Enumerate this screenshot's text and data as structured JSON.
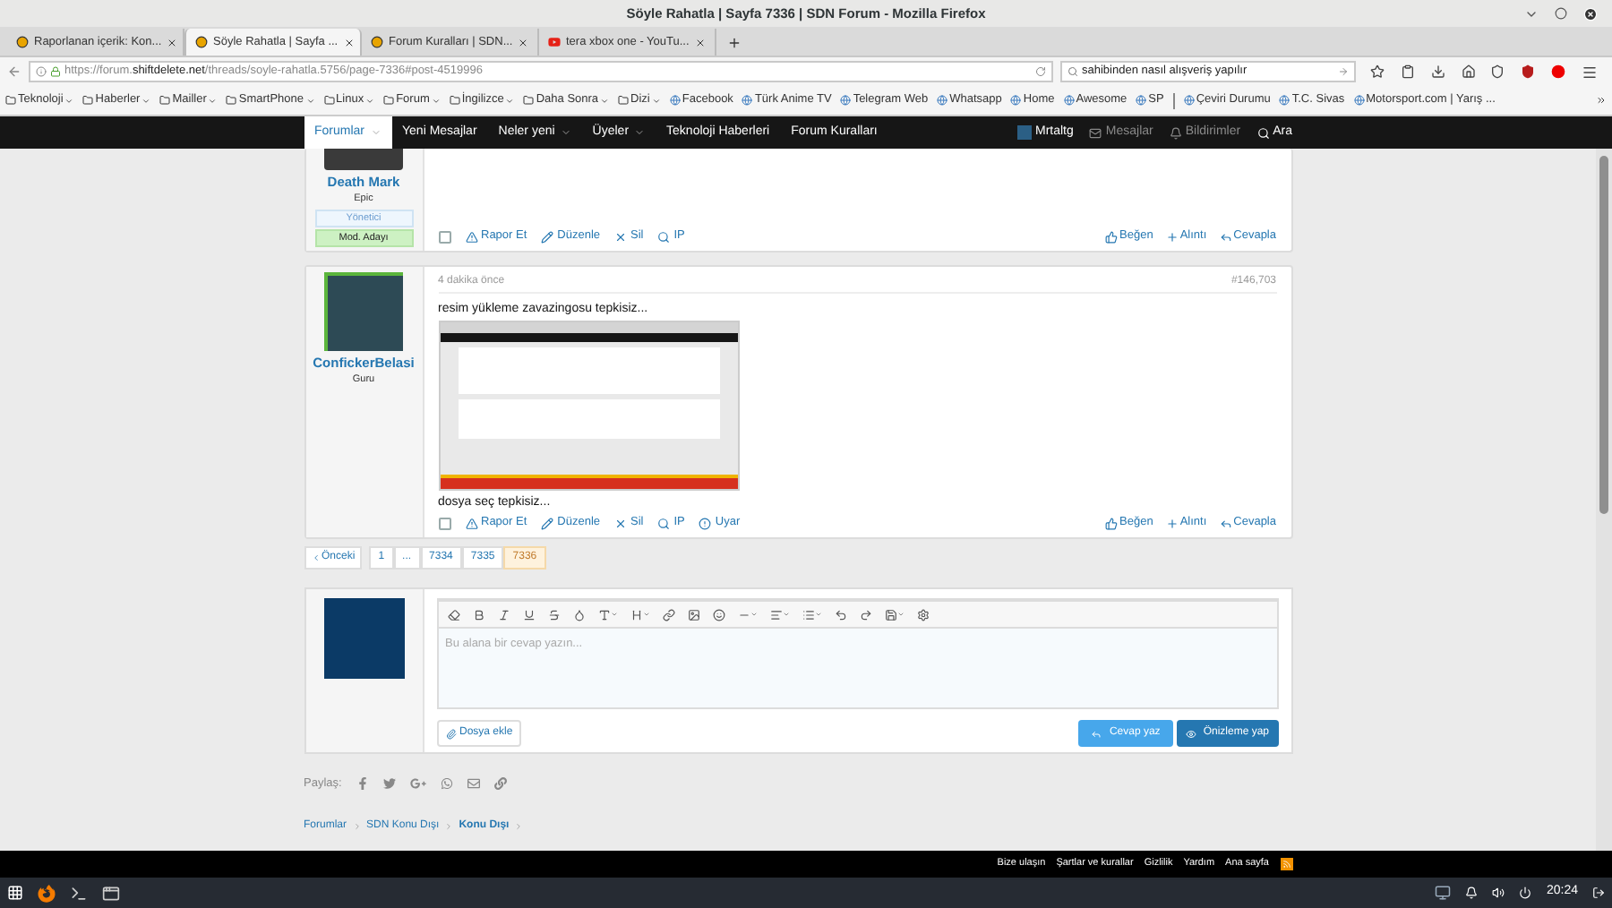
{
  "window": {
    "title": "Söyle Rahatla | Sayfa 7336 | SDN Forum - Mozilla Firefox"
  },
  "tabs": [
    {
      "label": "Raporlanan içerik: Kon...",
      "kind": "forum",
      "selected": false
    },
    {
      "label": "Söyle Rahatla | Sayfa ...",
      "kind": "forum",
      "selected": true
    },
    {
      "label": "Forum Kuralları | SDN...",
      "kind": "forum",
      "selected": false
    },
    {
      "label": "tera xbox one - YouTu...",
      "kind": "video",
      "selected": false
    }
  ],
  "address_bar": {
    "url": "https://forum.**shiftdelete.net**/threads/soyle-rahatla.5756/page-7336#post-4519996"
  },
  "search_bar": {
    "value": "sahibinden nasıl alışveriş yapılır"
  },
  "bookmarks": [
    {
      "label": "Teknoloji",
      "kind": "folder"
    },
    {
      "label": "Haberler",
      "kind": "folder"
    },
    {
      "label": "Mailler",
      "kind": "folder"
    },
    {
      "label": "SmartPhone",
      "kind": "folder"
    },
    {
      "label": "Linux",
      "kind": "folder"
    },
    {
      "label": "Forum",
      "kind": "folder"
    },
    {
      "label": "İngilizce",
      "kind": "folder"
    },
    {
      "label": "Daha Sonra",
      "kind": "folder"
    },
    {
      "label": "Dizi",
      "kind": "folder"
    },
    {
      "label": "Facebook",
      "kind": "site"
    },
    {
      "label": "Türk Anime TV",
      "kind": "site"
    },
    {
      "label": "Telegram Web",
      "kind": "site"
    },
    {
      "label": "Whatsapp",
      "kind": "site"
    },
    {
      "label": "Home",
      "kind": "site"
    },
    {
      "label": "Awesome",
      "kind": "site"
    },
    {
      "label": "SP",
      "kind": "site"
    },
    {
      "kind": "separator"
    },
    {
      "label": "Çeviri Durumu",
      "kind": "site"
    },
    {
      "label": "T.C. Sivas",
      "kind": "site"
    },
    {
      "label": "Motorsport.com | Yarış ...",
      "kind": "site"
    }
  ],
  "forum_nav": {
    "items": [
      {
        "label": "Forumlar",
        "dropdown": true,
        "selected": true
      },
      {
        "label": "Yeni Mesajlar",
        "dropdown": false,
        "selected": false
      },
      {
        "label": "Neler yeni",
        "dropdown": true,
        "selected": false
      },
      {
        "label": "Üyeler",
        "dropdown": true,
        "selected": false
      },
      {
        "label": "Teknoloji Haberleri",
        "dropdown": false,
        "selected": false
      },
      {
        "label": "Forum Kuralları",
        "dropdown": false,
        "selected": false
      }
    ],
    "user_links": [
      {
        "label": "Mrtaltg",
        "kind": "user",
        "dimmed": false
      },
      {
        "label": "Mesajlar",
        "kind": "messages",
        "dimmed": true
      },
      {
        "label": "Bildirimler",
        "kind": "alerts",
        "dimmed": true
      },
      {
        "label": "Ara",
        "kind": "search",
        "dimmed": false
      }
    ]
  },
  "posts": [
    {
      "author": "Death Mark",
      "user_title": "Epic",
      "banners": [
        {
          "label": "Yönetici",
          "kind": "staff"
        },
        {
          "label": "Mod. Adayı",
          "kind": "candidate"
        }
      ],
      "checked": false,
      "actions_left": [
        {
          "label": "Rapor Et",
          "kind": "report"
        },
        {
          "label": "Düzenle",
          "kind": "edit"
        },
        {
          "label": "Sil",
          "kind": "delete"
        },
        {
          "label": "IP",
          "kind": "ip"
        }
      ],
      "actions_right": [
        {
          "label": "Beğen",
          "kind": "like"
        },
        {
          "label": "Alıntı",
          "kind": "quote"
        },
        {
          "label": "Cevapla",
          "kind": "reply"
        }
      ]
    },
    {
      "author": "ConfickerBelasi",
      "user_title": "Guru",
      "checked": false,
      "time": "4 dakika önce",
      "number": "#146,703",
      "blocks": [
        {
          "kind": "text",
          "text": "resim yükleme zavazingosu tepkisiz..."
        },
        {
          "kind": "image"
        },
        {
          "kind": "text",
          "text": "dosya seç tepkisiz..."
        }
      ],
      "actions_left": [
        {
          "label": "Rapor Et",
          "kind": "report"
        },
        {
          "label": "Düzenle",
          "kind": "edit"
        },
        {
          "label": "Sil",
          "kind": "delete"
        },
        {
          "label": "IP",
          "kind": "ip"
        },
        {
          "label": "Uyar",
          "kind": "warn"
        }
      ],
      "actions_right": [
        {
          "label": "Beğen",
          "kind": "like"
        },
        {
          "label": "Alıntı",
          "kind": "quote"
        },
        {
          "label": "Cevapla",
          "kind": "reply"
        }
      ]
    }
  ],
  "pagination": {
    "previous": "Önceki",
    "pages": [
      {
        "label": "1",
        "selected": false
      },
      {
        "label": "...",
        "selected": false
      },
      {
        "label": "7334",
        "selected": false
      },
      {
        "label": "7335",
        "selected": false
      },
      {
        "label": "7336",
        "selected": true
      }
    ]
  },
  "reply_editor": {
    "placeholder": "Bu alana bir cevap yazın...",
    "attach_button": "Dosya ekle",
    "submit_button": "Cevap yaz",
    "preview_button": "Önizleme yap"
  },
  "share": {
    "label": "Paylaş:"
  },
  "breadcrumbs": [
    {
      "label": "Forumlar",
      "current": false
    },
    {
      "label": "SDN Konu Dışı",
      "current": false
    },
    {
      "label": "Konu Dışı",
      "current": true
    }
  ],
  "footer_links": [
    "Bize ulaşın",
    "Şartlar ve kurallar",
    "Gizlilik",
    "Yardım",
    "Ana sayfa"
  ],
  "taskbar": {
    "clock": "20:24"
  }
}
